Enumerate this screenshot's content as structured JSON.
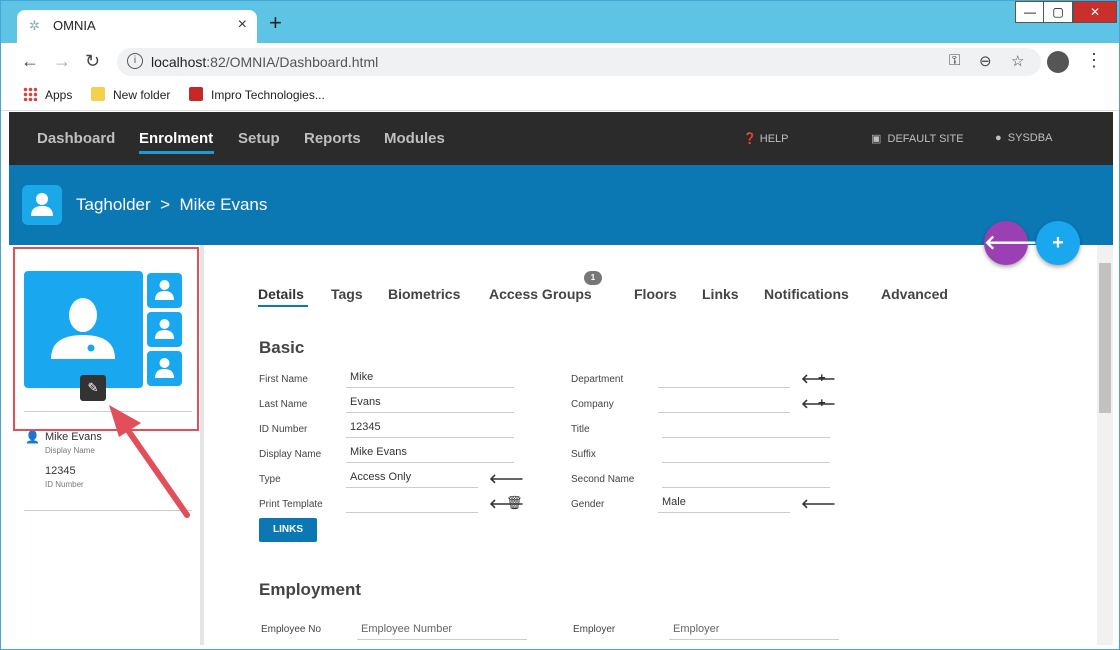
{
  "browser": {
    "tab_title": "OMNIA",
    "url_host": "localhost",
    "url_rest": ":82/OMNIA/Dashboard.html",
    "bookmarks": [
      "Apps",
      "New folder",
      "Impro Technologies..."
    ]
  },
  "appnav": {
    "items": [
      "Dashboard",
      "Enrolment",
      "Setup",
      "Reports",
      "Modules"
    ],
    "active": "Enrolment",
    "help": "HELP",
    "site": "DEFAULT SITE",
    "user": "SYSDBA"
  },
  "banner": {
    "section": "Tagholder",
    "separator": ">",
    "record": "Mike Evans"
  },
  "profile": {
    "name": "Mike Evans",
    "name_caption": "Display Name",
    "id": "12345",
    "id_caption": "ID Number"
  },
  "tabs": [
    "Details",
    "Tags",
    "Biometrics",
    "Access Groups",
    "Floors",
    "Links",
    "Notifications",
    "Advanced"
  ],
  "access_groups_badge": "1",
  "basic": {
    "title": "Basic",
    "first_name_label": "First Name",
    "first_name": "Mike",
    "last_name_label": "Last Name",
    "last_name": "Evans",
    "id_number_label": "ID Number",
    "id_number": "12345",
    "display_name_label": "Display Name",
    "display_name": "Mike Evans",
    "type_label": "Type",
    "type": "Access Only",
    "print_template_label": "Print Template",
    "print_template": "",
    "department_label": "Department",
    "department": "",
    "company_label": "Company",
    "company": "",
    "title_label": "Title",
    "title_value": "",
    "suffix_label": "Suffix",
    "suffix": "",
    "second_name_label": "Second Name",
    "second_name": "",
    "gender_label": "Gender",
    "gender": "Male",
    "links_button": "LINKS"
  },
  "employment": {
    "title": "Employment",
    "employee_no_label": "Employee No",
    "employee_no_placeholder": "Employee Number",
    "employer_label": "Employer",
    "employer_placeholder": "Employer"
  },
  "colors": {
    "nav_bg": "#2b2b2b",
    "banner_bg": "#0b78b4",
    "accent": "#19a8ef",
    "fab_back": "#9b3fb5",
    "fab_add": "#19a8ef",
    "highlight": "#e04f5a"
  }
}
